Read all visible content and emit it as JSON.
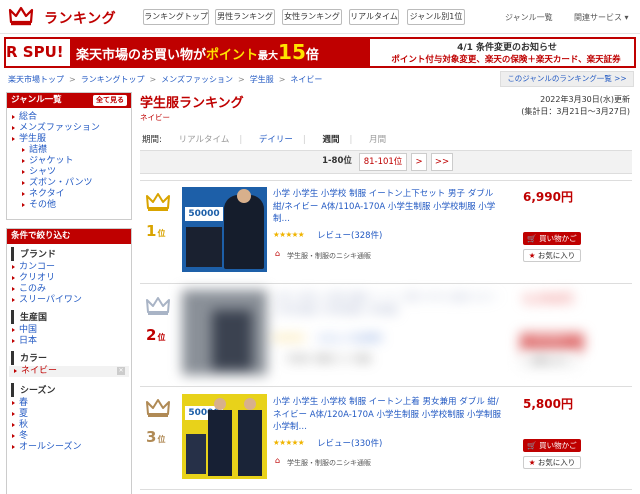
{
  "header": {
    "logo_text": "ランキング",
    "tabs": [
      "ランキングトップ",
      "男性ランキング",
      "女性ランキング",
      "リアルタイム",
      "ジャンル別1位"
    ],
    "right_links": [
      "ジャンル一覧",
      "関連サービス"
    ]
  },
  "banner": {
    "spu": "R SPU!",
    "headline_a": "楽天市場のお買い物が",
    "headline_b": "ポイント",
    "headline_c": "最大",
    "headline_big": "15",
    "headline_d": "倍",
    "notice_title": "4/1 条件変更のお知らせ",
    "notice_text": "ポイント付与対象変更、楽天の保険＋楽天カード、楽天証券"
  },
  "breadcrumb": [
    "楽天市場トップ",
    "ランキングトップ",
    "メンズファッション",
    "学生服",
    "ネイビー"
  ],
  "genre_ranking_link": "このジャンルのランキング一覧 >>",
  "sidebar": {
    "genre_title": "ジャンル一覧",
    "see_all": "全て見る",
    "genres": [
      {
        "label": "総合",
        "level": 0
      },
      {
        "label": "メンズファッション",
        "level": 0
      },
      {
        "label": "学生服",
        "level": 0
      },
      {
        "label": "詰襟",
        "level": 1
      },
      {
        "label": "ジャケット",
        "level": 1
      },
      {
        "label": "シャツ",
        "level": 1
      },
      {
        "label": "ズボン・パンツ",
        "level": 1
      },
      {
        "label": "ネクタイ",
        "level": 1
      },
      {
        "label": "その他",
        "level": 1
      }
    ],
    "filter_title": "条件で絞り込む",
    "brand_title": "ブランド",
    "brands": [
      "カンコー",
      "クリオリ",
      "このみ",
      "スリーパイワン"
    ],
    "origin_title": "生産国",
    "origins": [
      "中国",
      "日本"
    ],
    "color_title": "カラー",
    "color_selected": "ネイビー",
    "season_title": "シーズン",
    "seasons": [
      "春",
      "夏",
      "秋",
      "冬",
      "オールシーズン"
    ]
  },
  "main": {
    "title": "学生服ランキング",
    "subtitle": "ネイビー",
    "updated": "2022年3月30日(水)更新",
    "period_range": "(集計日：3月21日～3月27日)",
    "period_label": "期間:",
    "periods": [
      "リアルタイム",
      "デイリー",
      "週間",
      "月間"
    ],
    "pager": {
      "current": "1-80位",
      "next_range": "81-101位",
      "next": ">",
      "last": ">>"
    }
  },
  "items": [
    {
      "rank": "1",
      "rank_suffix": "位",
      "name": "小学 小学生 小学校 制服 イートン上下セット 男子 ダブル 紺/ネイビー A体/110A-170A 小学生制服 小学校制服 小学制…",
      "stars": "★★★★★",
      "review": "レビュー(328件)",
      "shop": "学生服・制服のニシキ通販",
      "price": "6,990円",
      "thumb_text": "50000",
      "crown_color": "#d9a400"
    },
    {
      "rank": "2",
      "rank_suffix": "位",
      "name": "小学 小学生 小学校 制服 イートン 男子 ダブル 紺/ネイビー 小学生制服 小学校制服 小学制服",
      "stars": "★★★★★",
      "review": "レビュー(120件)",
      "shop": "学生服・制服のニシキ通販",
      "price": "4,990円",
      "thumb_text": "",
      "crown_color": "#a9b4c6"
    },
    {
      "rank": "3",
      "rank_suffix": "位",
      "name": "小学 小学生 小学校 制服 イートン上着 男女兼用 ダブル 紺/ネイビー A体/120A-170A 小学生制服 小学校制服 小学制服 小学制…",
      "stars": "★★★★★",
      "review": "レビュー(330件)",
      "shop": "学生服・制服のニシキ通販",
      "price": "5,800円",
      "thumb_text": "50000",
      "crown_color": "#b08a55"
    }
  ],
  "buttons": {
    "cart": "買い物かご",
    "fav": "お気に入り"
  }
}
